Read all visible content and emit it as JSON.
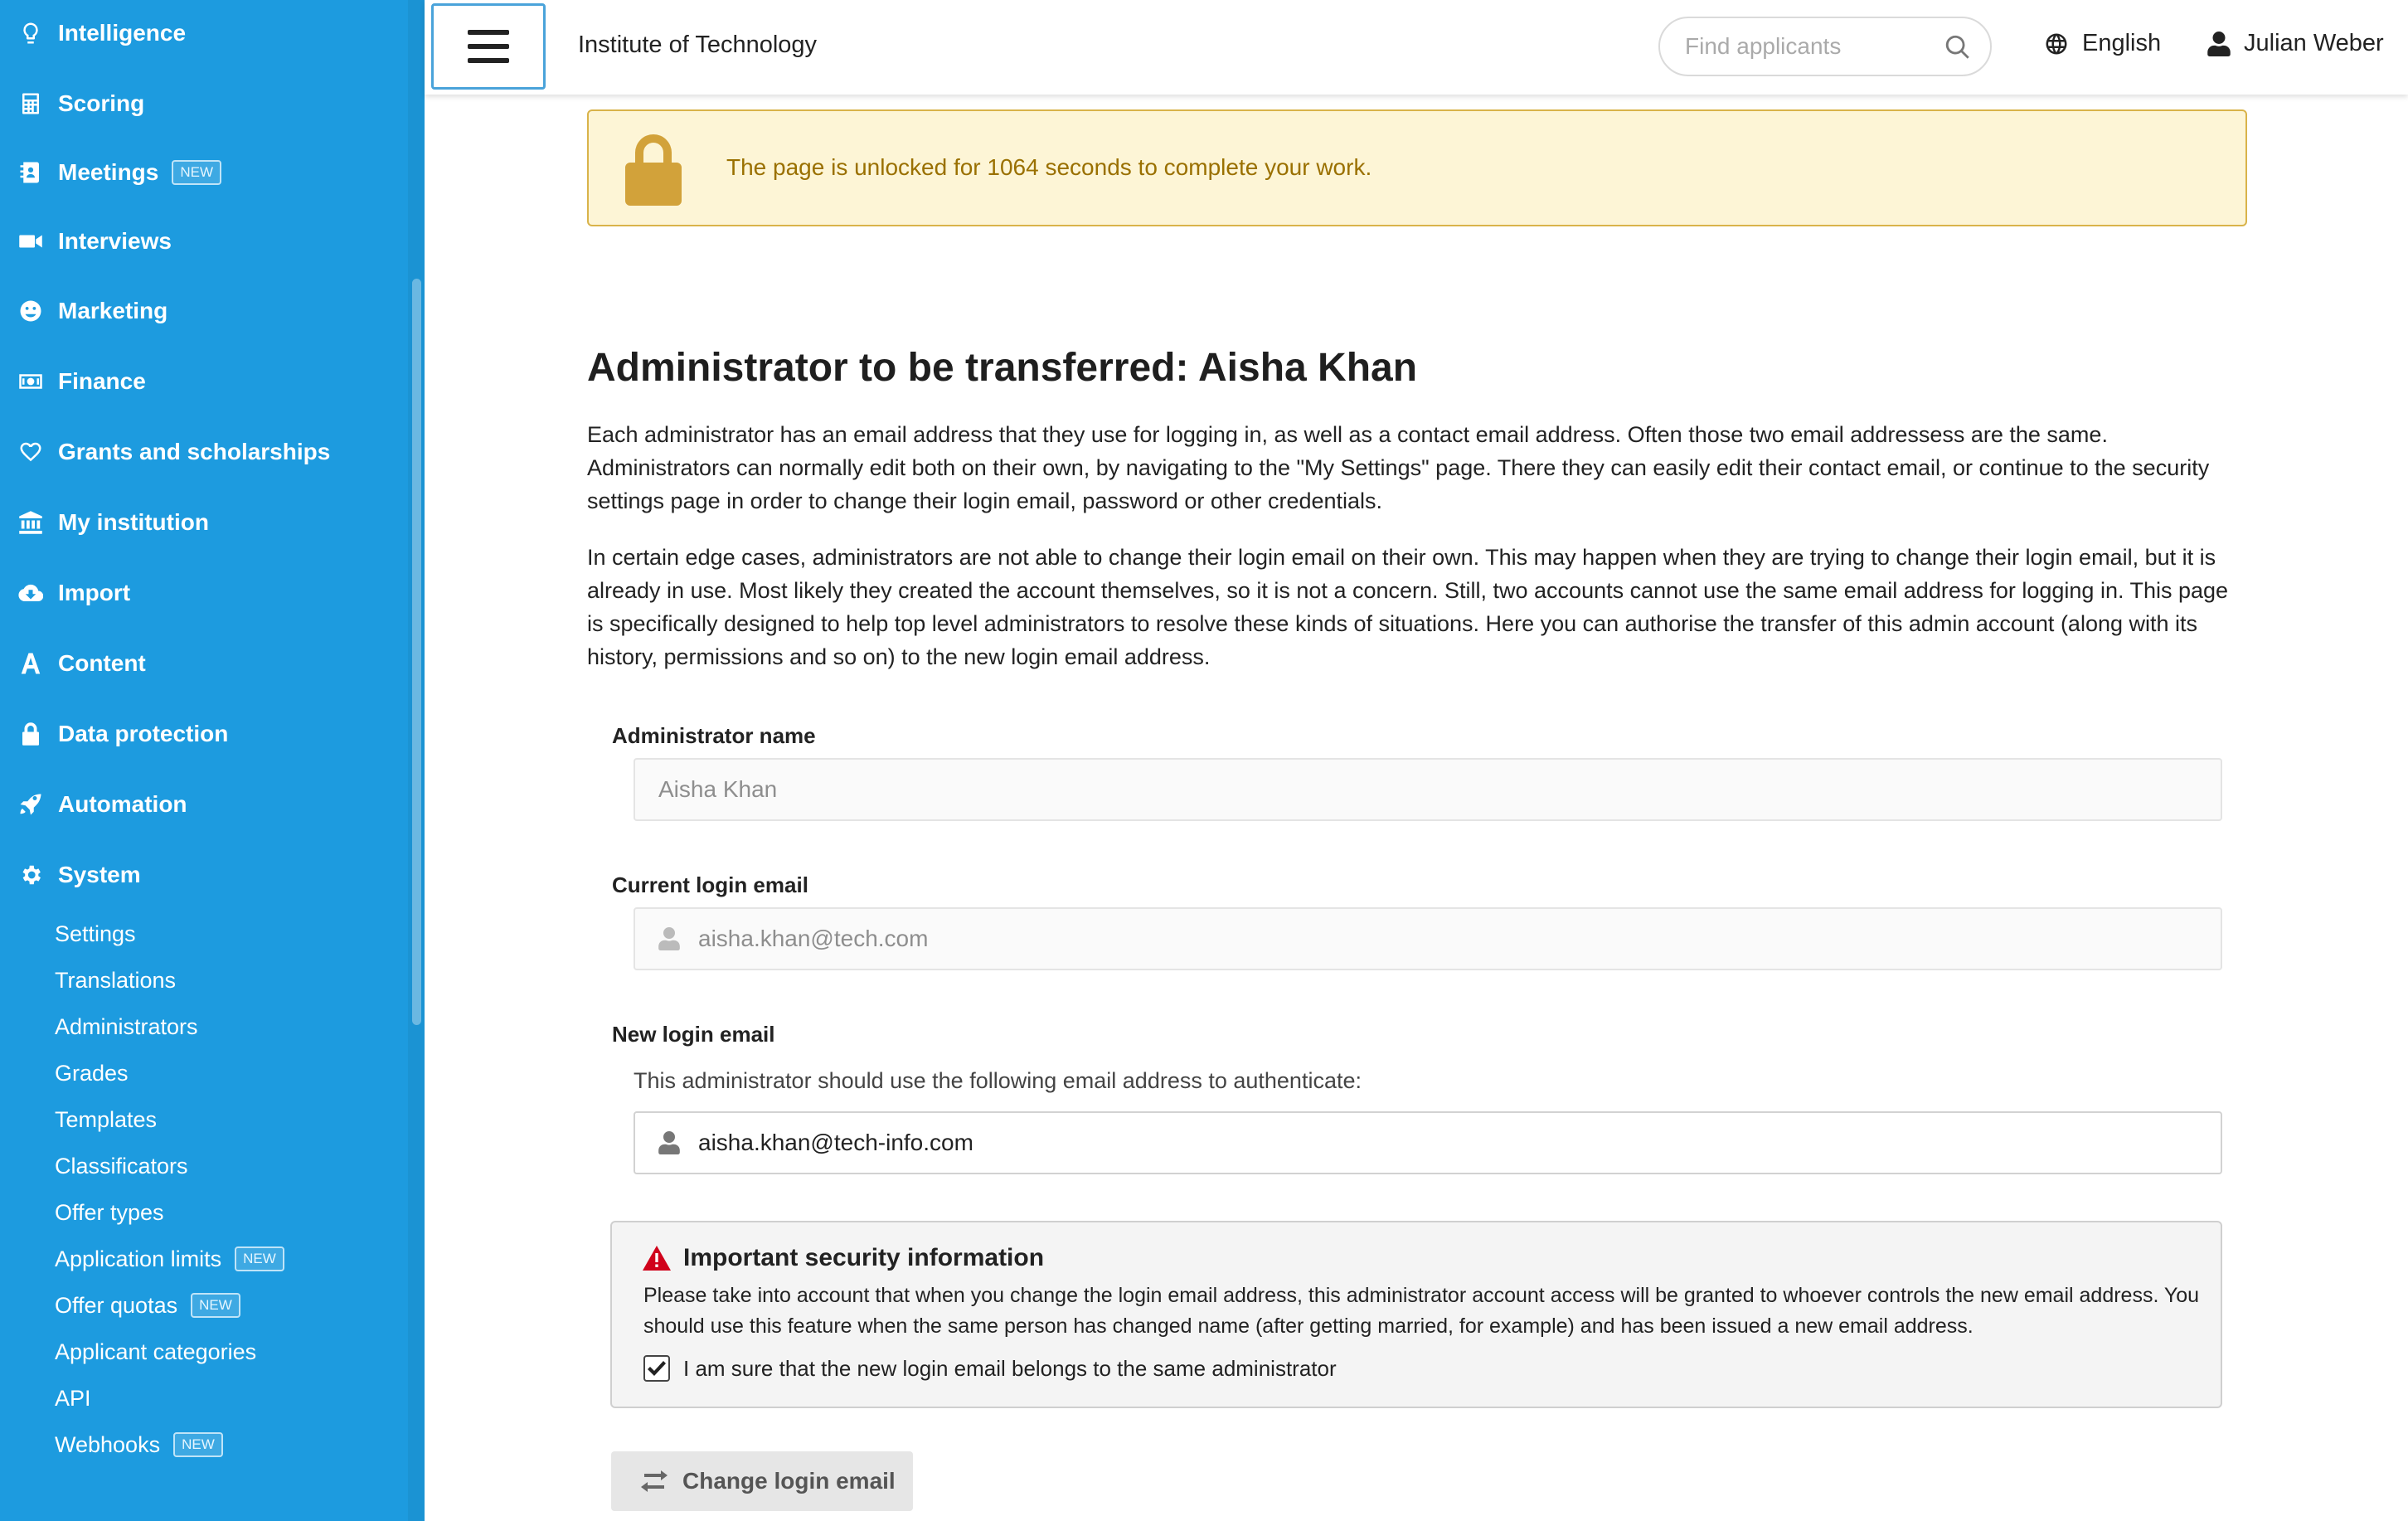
{
  "sidebar": {
    "items": [
      {
        "label": "Intelligence",
        "icon": "lightbulb-icon"
      },
      {
        "label": "Scoring",
        "icon": "calculator-icon"
      },
      {
        "label": "Meetings",
        "icon": "address-book-icon",
        "badge": "NEW"
      },
      {
        "label": "Interviews",
        "icon": "video-camera-icon"
      },
      {
        "label": "Marketing",
        "icon": "smile-icon"
      },
      {
        "label": "Finance",
        "icon": "money-bill-icon"
      },
      {
        "label": "Grants and scholarships",
        "icon": "heart-icon"
      },
      {
        "label": "My institution",
        "icon": "institution-icon"
      },
      {
        "label": "Import",
        "icon": "cloud-download-icon"
      },
      {
        "label": "Content",
        "icon": "font-icon"
      },
      {
        "label": "Data protection",
        "icon": "lock-icon"
      },
      {
        "label": "Automation",
        "icon": "rocket-icon"
      },
      {
        "label": "System",
        "icon": "gear-icon"
      }
    ],
    "system_subitems": [
      {
        "label": "Settings"
      },
      {
        "label": "Translations"
      },
      {
        "label": "Administrators"
      },
      {
        "label": "Grades"
      },
      {
        "label": "Templates"
      },
      {
        "label": "Classificators"
      },
      {
        "label": "Offer types"
      },
      {
        "label": "Application limits",
        "badge": "NEW"
      },
      {
        "label": "Offer quotas",
        "badge": "NEW"
      },
      {
        "label": "Applicant categories"
      },
      {
        "label": "API"
      },
      {
        "label": "Webhooks",
        "badge": "NEW"
      }
    ]
  },
  "header": {
    "org_name": "Institute of Technology",
    "search_placeholder": "Find applicants",
    "language": "English",
    "user_name": "Julian Weber"
  },
  "alert": {
    "message": "The page is unlocked for 1064 seconds to complete your work."
  },
  "main": {
    "title": "Administrator to be transferred: Aisha Khan",
    "paragraph1": "Each administrator has an email address that they use for logging in, as well as a contact email address. Often those two email addressess are the same. Administrators can normally edit both on their own, by navigating to the \"My Settings\" page. There they can easily edit their contact email, or continue to the security settings page in order to change their login email, password or other credentials.",
    "paragraph2": "In certain edge cases, administrators are not able to change their login email on their own. This may happen when they are trying to change their login email, but it is already in use. Most likely they created the account themselves, so it is not a concern. Still, two accounts cannot use the same email address for logging in. This page is specifically designed to help top level administrators to resolve these kinds of situations. Here you can authorise the transfer of this admin account (along with its history, permissions and so on) to the new login email address.",
    "admin_name_label": "Administrator name",
    "admin_name_value": "Aisha Khan",
    "current_email_label": "Current login email",
    "current_email_value": "aisha.khan@tech.com",
    "new_email_label": "New login email",
    "new_email_helper": "This administrator should use the following email address to authenticate:",
    "new_email_value": "aisha.khan@tech-info.com"
  },
  "security": {
    "title": "Important security information",
    "text": "Please take into account that when you change the login email address, this administrator account access will be granted to whoever controls the new email address. You should use this feature when the same person has changed name (after getting married, for example) and has been issued a new email address.",
    "checkbox_label": "I am sure that the new login email belongs to the same administrator",
    "checkbox_checked": true
  },
  "actions": {
    "change_label": "Change login email"
  },
  "colors": {
    "sidebar_bg": "#1d9bdf",
    "alert_bg": "#fdf5d6",
    "alert_text": "#9a7000",
    "warning_red": "#d0021b"
  }
}
